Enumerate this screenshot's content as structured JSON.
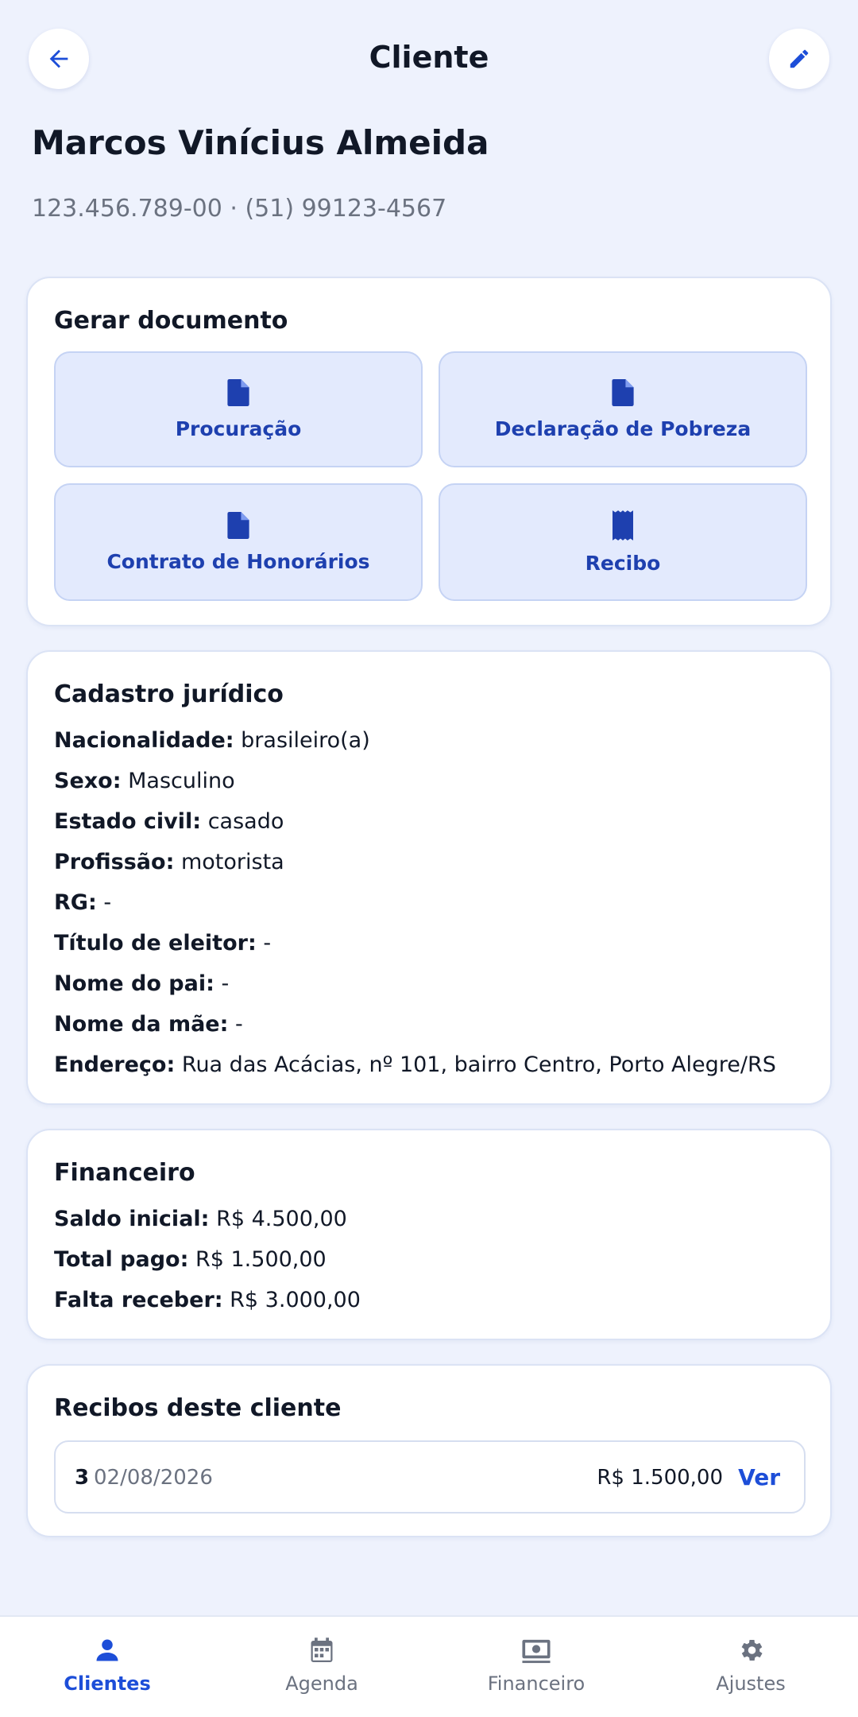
{
  "header": {
    "title": "Cliente",
    "back_icon": "arrow-left-icon",
    "edit_icon": "pencil-icon"
  },
  "client": {
    "name": "Marcos Vinícius Almeida",
    "meta": "123.456.789-00 · (51) 99123-4567"
  },
  "documents": {
    "title": "Gerar documento",
    "items": [
      {
        "label": "Procuração",
        "icon": "document-icon"
      },
      {
        "label": "Declaração de Pobreza",
        "icon": "document-icon"
      },
      {
        "label": "Contrato de Honorários",
        "icon": "document-icon"
      },
      {
        "label": "Recibo",
        "icon": "receipt-icon"
      }
    ]
  },
  "cadastro": {
    "title": "Cadastro jurídico",
    "fields": [
      {
        "key": "Nacionalidade:",
        "value": "brasileiro(a)"
      },
      {
        "key": "Sexo:",
        "value": "Masculino"
      },
      {
        "key": "Estado civil:",
        "value": "casado"
      },
      {
        "key": "Profissão:",
        "value": "motorista"
      },
      {
        "key": "RG:",
        "value": "-"
      },
      {
        "key": "Título de eleitor:",
        "value": "-"
      },
      {
        "key": "Nome do pai:",
        "value": "-"
      },
      {
        "key": "Nome da mãe:",
        "value": "-"
      },
      {
        "key": "Endereço:",
        "value": "Rua das Acácias, nº 101, bairro Centro, Porto Alegre/RS"
      }
    ]
  },
  "financeiro": {
    "title": "Financeiro",
    "fields": [
      {
        "key": "Saldo inicial:",
        "value": "R$ 4.500,00"
      },
      {
        "key": "Total pago:",
        "value": "R$ 1.500,00"
      },
      {
        "key": "Falta receber:",
        "value": "R$ 3.000,00"
      }
    ]
  },
  "recibos": {
    "title": "Recibos deste cliente",
    "items": [
      {
        "number": "3",
        "date": "02/08/2026",
        "amount": "R$ 1.500,00",
        "action": "Ver"
      }
    ]
  },
  "nav": {
    "items": [
      {
        "label": "Clientes",
        "icon": "person-icon",
        "active": true
      },
      {
        "label": "Agenda",
        "icon": "calendar-icon",
        "active": false
      },
      {
        "label": "Financeiro",
        "icon": "banknote-icon",
        "active": false
      },
      {
        "label": "Ajustes",
        "icon": "gear-icon",
        "active": false
      }
    ]
  },
  "colors": {
    "background": "#eef2fd",
    "accent": "#1d4ed8",
    "doc_button_bg": "#e3eafd",
    "doc_icon": "#1e40af"
  }
}
